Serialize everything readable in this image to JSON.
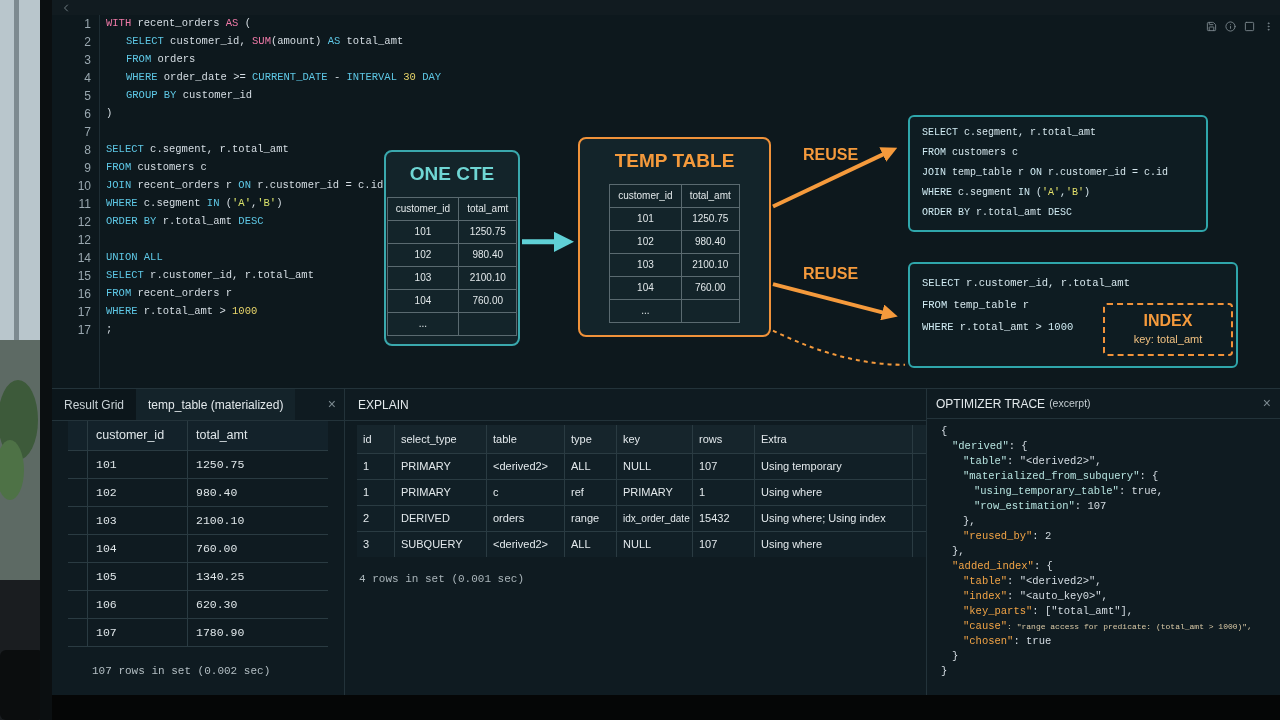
{
  "editor": {
    "lines": [
      {
        "num": "1",
        "tokens": [
          {
            "kind": "kw_alt",
            "text": "WITH"
          },
          {
            "kind": "text",
            "text": " recent_orders "
          },
          {
            "kind": "kw_alt",
            "text": "AS"
          },
          {
            "kind": "text",
            "text": " ("
          }
        ],
        "children": [
          {
            "num": "2",
            "tokens": [
              {
                "kind": "kw",
                "text": "SELECT"
              },
              {
                "kind": "text",
                "text": " customer_id, "
              },
              {
                "kind": "kw_alt",
                "text": "SUM"
              },
              {
                "kind": "text",
                "text": "(amount) "
              },
              {
                "kind": "kw",
                "text": "AS"
              },
              {
                "kind": "text",
                "text": " total_amt"
              }
            ]
          },
          {
            "num": "3",
            "tokens": [
              {
                "kind": "kw",
                "text": "FROM"
              },
              {
                "kind": "text",
                "text": " orders"
              }
            ]
          },
          {
            "num": "4",
            "tokens": [
              {
                "kind": "kw",
                "text": "WHERE"
              },
              {
                "kind": "text",
                "text": " order_date >= "
              },
              {
                "kind": "kw",
                "text": "CURRENT_DATE"
              },
              {
                "kind": "text",
                "text": " - "
              },
              {
                "kind": "kw",
                "text": "INTERVAL "
              },
              {
                "kind": "num",
                "text": "30 "
              },
              {
                "kind": "kw",
                "text": "DAY"
              }
            ]
          },
          {
            "num": "5",
            "tokens": [
              {
                "kind": "kw",
                "text": "GROUP BY"
              },
              {
                "kind": "text",
                "text": " customer_id"
              }
            ]
          }
        ]
      },
      {
        "num": "6",
        "tokens": [
          {
            "kind": "text",
            "text": ")"
          }
        ]
      },
      {
        "num": "7"
      },
      {
        "num": "8",
        "tokens": [
          {
            "kind": "kw",
            "text": "SELECT"
          },
          {
            "kind": "text",
            "text": " c.segment, r.total_amt"
          }
        ]
      },
      {
        "num": "9",
        "tokens": [
          {
            "kind": "kw",
            "text": "FROM"
          },
          {
            "kind": "text",
            "text": " customers c"
          }
        ]
      },
      {
        "num": "10",
        "tokens": [
          {
            "kind": "kw",
            "text": "JOIN"
          },
          {
            "kind": "text",
            "text": " recent_orders r "
          },
          {
            "kind": "kw",
            "text": "ON"
          },
          {
            "kind": "text",
            "text": " r.customer_id = c.id"
          }
        ]
      },
      {
        "num": "11",
        "tokens": [
          {
            "kind": "kw",
            "text": "WHERE"
          },
          {
            "kind": "text",
            "text": " c.segment "
          },
          {
            "kind": "kw",
            "text": "IN"
          },
          {
            "kind": "text",
            "text": " ("
          },
          {
            "kind": "str",
            "text": "'A'"
          },
          {
            "kind": "text",
            "text": ","
          },
          {
            "kind": "str",
            "text": "'B'"
          },
          {
            "kind": "text",
            "text": ")"
          }
        ]
      },
      {
        "num": "12",
        "tokens": [
          {
            "kind": "kw",
            "text": "ORDER BY"
          },
          {
            "kind": "text",
            "text": " r.total_amt "
          },
          {
            "kind": "kw",
            "text": "DESC"
          }
        ]
      },
      {
        "num": "12"
      },
      {
        "num": "14",
        "tokens": [
          {
            "kind": "kw",
            "text": "UNION ALL"
          }
        ]
      },
      {
        "num": "15",
        "tokens": [
          {
            "kind": "kw",
            "text": "SELECT"
          },
          {
            "kind": "text",
            "text": " r.customer_id, r.total_amt"
          }
        ]
      },
      {
        "num": "16",
        "tokens": [
          {
            "kind": "kw",
            "text": "FROM"
          },
          {
            "kind": "text",
            "text": " recent_orders r"
          }
        ]
      },
      {
        "num": "17",
        "tokens": [
          {
            "kind": "kw",
            "text": "WHERE"
          },
          {
            "kind": "text",
            "text": " r.total_amt > "
          },
          {
            "kind": "num",
            "text": "1000"
          }
        ]
      },
      {
        "num": "17",
        "tokens": [
          {
            "kind": "text",
            "text": ";"
          }
        ]
      }
    ]
  },
  "diagram": {
    "cte": {
      "title": "ONE CTE",
      "columns": [
        "customer_id",
        "total_amt"
      ],
      "rows": [
        [
          "101",
          "1250.75"
        ],
        [
          "102",
          "980.40"
        ],
        [
          "103",
          "2100.10"
        ],
        [
          "104",
          "760.00"
        ],
        [
          "...",
          ""
        ]
      ]
    },
    "temp_table": {
      "title": "TEMP TABLE",
      "columns": [
        "customer_id",
        "total_amt"
      ],
      "rows": [
        [
          "101",
          "1250.75"
        ],
        [
          "102",
          "980.40"
        ],
        [
          "103",
          "2100.10"
        ],
        [
          "104",
          "760.00"
        ],
        [
          "...",
          ""
        ]
      ]
    },
    "reuse_labels": [
      "REUSE",
      "REUSE"
    ],
    "queries": [
      {
        "lines": [
          {
            "tokens": [
              {
                "kind": "kw",
                "text": "SELECT"
              },
              {
                "kind": "text",
                "text": " c.segment, r.total_amt"
              }
            ]
          },
          {
            "tokens": [
              {
                "kind": "kw",
                "text": "FROM"
              },
              {
                "kind": "text",
                "text": " customers c"
              }
            ]
          },
          {
            "tokens": [
              {
                "kind": "kw",
                "text": "JOIN"
              },
              {
                "kind": "text",
                "text": " temp_table r "
              },
              {
                "kind": "kw",
                "text": "ON"
              },
              {
                "kind": "text",
                "text": " r.customer_id = c.id"
              }
            ]
          },
          {
            "tokens": [
              {
                "kind": "kw",
                "text": "WHERE"
              },
              {
                "kind": "text",
                "text": " c.segment "
              },
              {
                "kind": "kw",
                "text": "IN"
              },
              {
                "kind": "text",
                "text": " ("
              },
              {
                "kind": "str",
                "text": "'A'"
              },
              {
                "kind": "text",
                "text": ","
              },
              {
                "kind": "str",
                "text": "'B'"
              },
              {
                "kind": "text",
                "text": ")"
              }
            ]
          },
          {
            "tokens": [
              {
                "kind": "kw",
                "text": "ORDER BY"
              },
              {
                "kind": "text",
                "text": " r.total_amt "
              },
              {
                "kind": "kw",
                "text": "DESC"
              }
            ]
          }
        ]
      },
      {
        "lines": [
          {
            "tokens": [
              {
                "kind": "kw",
                "text": "SELECT"
              },
              {
                "kind": "text",
                "text": " r.customer_id, r.total_amt"
              }
            ]
          },
          {
            "tokens": [
              {
                "kind": "kw",
                "text": "FROM"
              },
              {
                "kind": "text",
                "text": " temp_table r"
              }
            ]
          },
          {
            "tokens": [
              {
                "kind": "kw",
                "text": "WHERE"
              },
              {
                "kind": "text",
                "text": " r.total_amt > "
              },
              {
                "kind": "kw",
                "text": "1000"
              }
            ]
          }
        ],
        "index": {
          "title": "INDEX",
          "key": "key: total_amt"
        }
      }
    ]
  },
  "result_panel": {
    "tabs": [
      {
        "label": "Result Grid",
        "selected": false
      },
      {
        "label": "temp_table (materialized)",
        "selected": true
      }
    ],
    "close": "×",
    "columns": [
      "customer_id",
      "total_amt"
    ],
    "rows": [
      [
        "101",
        "1250.75"
      ],
      [
        "102",
        "980.40"
      ],
      [
        "103",
        "2100.10"
      ],
      [
        "104",
        "760.00"
      ],
      [
        "105",
        "1340.25"
      ],
      [
        "106",
        "620.30"
      ],
      [
        "107",
        "1780.90"
      ]
    ],
    "status": "107 rows in set (0.002 sec)"
  },
  "explain_panel": {
    "title": "EXPLAIN",
    "columns": [
      "id",
      "select_type",
      "table",
      "type",
      "key",
      "rows",
      "Extra"
    ],
    "rows": [
      [
        "1",
        "PRIMARY",
        "<derived2>",
        "ALL",
        "NULL",
        "107",
        "Using temporary"
      ],
      [
        "1",
        "PRIMARY",
        "c",
        "ref",
        "PRIMARY",
        "1",
        "Using where"
      ],
      [
        "2",
        "DERIVED",
        "orders",
        "range",
        "idx_order_date",
        "15432",
        "Using where; Using index"
      ],
      [
        "3",
        "SUBQUERY",
        "<derived2>",
        "ALL",
        "NULL",
        "107",
        "Using where"
      ]
    ],
    "status": "4 rows in set (0.001 sec)"
  },
  "trace_panel": {
    "title": "OPTIMIZER TRACE",
    "subtitle": "(excerpt)",
    "close": "×",
    "lines": [
      {
        "tokens": [
          {
            "kind": "text",
            "text": "{"
          }
        ],
        "children": [
          {
            "tokens": [
              {
                "kind": "key",
                "text": "\"derived\""
              },
              {
                "kind": "text",
                "text": ": {"
              }
            ],
            "children": [
              {
                "tokens": [
                  {
                    "kind": "key",
                    "text": "\"table\""
                  },
                  {
                    "kind": "text",
                    "text": ": \"<derived2>\","
                  }
                ]
              },
              {
                "tokens": [
                  {
                    "kind": "key",
                    "text": "\"materialized_from_subquery\""
                  },
                  {
                    "kind": "text",
                    "text": ": {"
                  }
                ],
                "children": [
                  {
                    "tokens": [
                      {
                        "kind": "key",
                        "text": "\"using_temporary_table\""
                      },
                      {
                        "kind": "text",
                        "text": ": true,"
                      }
                    ]
                  },
                  {
                    "tokens": [
                      {
                        "kind": "key",
                        "text": "\"row_estimation\""
                      },
                      {
                        "kind": "text",
                        "text": ": 107"
                      }
                    ]
                  }
                ]
              },
              {
                "tokens": [
                  {
                    "kind": "text",
                    "text": "},"
                  }
                ]
              },
              {
                "tokens": [
                  {
                    "kind": "hkey",
                    "text": "\"reused_by\""
                  },
                  {
                    "kind": "text",
                    "text": ": 2"
                  }
                ]
              }
            ]
          },
          {
            "tokens": [
              {
                "kind": "text",
                "text": "},"
              }
            ]
          },
          {
            "tokens": [
              {
                "kind": "hkey",
                "text": "\"added_index\""
              },
              {
                "kind": "text",
                "text": ": {"
              }
            ],
            "children": [
              {
                "tokens": [
                  {
                    "kind": "hkey",
                    "text": "\"table\""
                  },
                  {
                    "kind": "text",
                    "text": ": \"<derived2>\","
                  }
                ]
              },
              {
                "tokens": [
                  {
                    "kind": "hkey",
                    "text": "\"index\""
                  },
                  {
                    "kind": "text",
                    "text": ": \"<auto_key0>\","
                  }
                ]
              },
              {
                "tokens": [
                  {
                    "kind": "hkey",
                    "text": "\"key_parts\""
                  },
                  {
                    "kind": "text",
                    "text": ": [\"total_amt\"],"
                  }
                ]
              },
              {
                "tokens": [
                  {
                    "kind": "hkey",
                    "text": "\"cause\""
                  },
                  {
                    "kind": "note",
                    "text": ": \"range access for predicate: (total_amt > 1000)\","
                  }
                ]
              },
              {
                "tokens": [
                  {
                    "kind": "hkey",
                    "text": "\"chosen\""
                  },
                  {
                    "kind": "text",
                    "text": ": true"
                  }
                ]
              }
            ]
          },
          {
            "tokens": [
              {
                "kind": "text",
                "text": "}"
              }
            ]
          }
        ]
      },
      {
        "tokens": [
          {
            "kind": "text",
            "text": "}"
          }
        ]
      }
    ]
  }
}
